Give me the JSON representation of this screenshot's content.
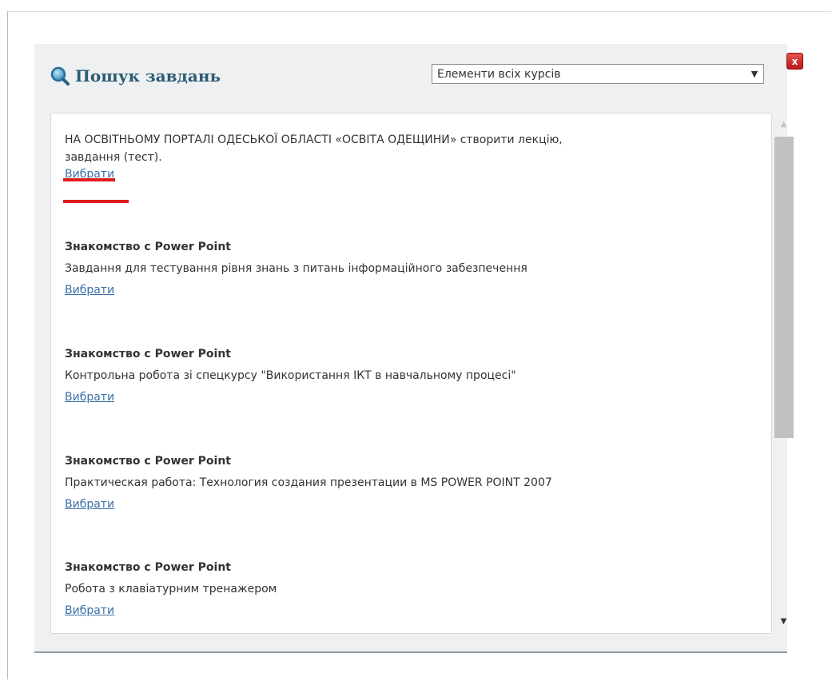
{
  "dialog": {
    "title": "Пошук завдань",
    "close_label": "x"
  },
  "filter": {
    "selected": "Елементи всіх курсів",
    "chevron": "▼"
  },
  "tasks": [
    {
      "title": "",
      "desc_line1": "НА ОСВІТНЬОМУ ПОРТАЛІ ОДЕСЬКОЇ ОБЛАСТІ «ОСВІТА ОДЕЩИНИ» створити лекцію,",
      "desc_line2": "завдання (тест).",
      "link": "Вибрати"
    },
    {
      "title": "Знакомство с Power Point",
      "desc": "Завдання для тестування рівня знань з питань інформаційного забезпечення",
      "link": "Вибрати"
    },
    {
      "title": "Знакомство с Power Point",
      "desc": "Контрольна робота зі спецкурсу \"Використання ІКТ в навчальному процесі\"",
      "link": "Вибрати"
    },
    {
      "title": "Знакомство с Power Point",
      "desc": "Практическая работа: Технология создания презентации в MS POWER POINT 2007",
      "link": "Вибрати"
    },
    {
      "title": "Знакомство с Power Point",
      "desc": "Робота з клавіатурним тренажером",
      "link": "Вибрати"
    }
  ],
  "scrollbar": {
    "up": "▲",
    "down": "▼"
  },
  "colors": {
    "title": "#2b5c73",
    "link": "#3a6fa8",
    "highlight": "#e01b1b",
    "close": "#cc2222"
  }
}
